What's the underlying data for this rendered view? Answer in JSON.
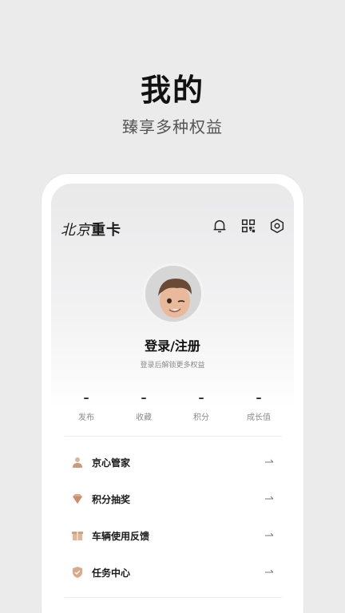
{
  "promo": {
    "title": "我的",
    "subtitle": "臻享多种权益"
  },
  "app": {
    "logo_left": "北京",
    "logo_right": "重卡"
  },
  "header": {
    "icons": [
      "bell-icon",
      "qr-code-icon",
      "settings-icon"
    ]
  },
  "profile": {
    "login_label": "登录/注册",
    "login_hint": "登录后解锁更多权益"
  },
  "stats": [
    {
      "value": "–",
      "label": "发布"
    },
    {
      "value": "–",
      "label": "收藏"
    },
    {
      "value": "–",
      "label": "积分"
    },
    {
      "value": "–",
      "label": "成长值"
    }
  ],
  "menu": [
    {
      "label": "京心管家",
      "icon": "person-icon"
    },
    {
      "label": "积分抽奖",
      "icon": "diamond-icon"
    },
    {
      "label": "车辆使用反馈",
      "icon": "box-icon"
    },
    {
      "label": "任务中心",
      "icon": "shield-icon"
    }
  ],
  "colors": {
    "background": "#ebebeb",
    "icon_accent": "#d9b79a",
    "text_primary": "#111111",
    "text_secondary": "#8a8a8a"
  }
}
